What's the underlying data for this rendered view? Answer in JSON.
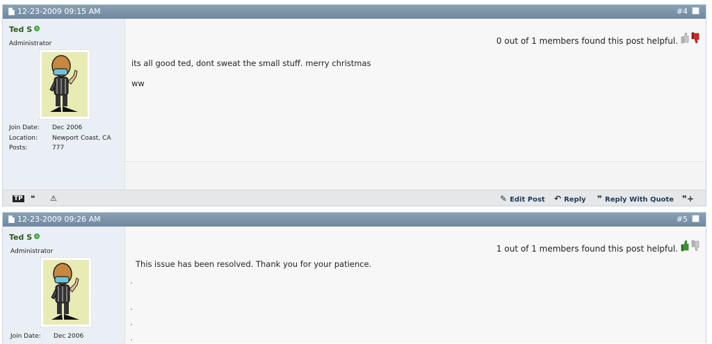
{
  "posts": [
    {
      "date": "12-23-2009 09:15 AM",
      "number": "#4",
      "user": {
        "name": "Ted S",
        "title": "Administrator"
      },
      "meta": [
        {
          "key": "Join Date:",
          "value": "Dec 2006"
        },
        {
          "key": "Location:",
          "value": "Newport Coast, CA"
        },
        {
          "key": "Posts:",
          "value": "777"
        }
      ],
      "helpful": "0 out of 1 members found this post helpful.",
      "message_lines": [
        "its all good ted, dont sweat the small stuff. merry christmas",
        "ww"
      ],
      "footer": {
        "edit_label": "Edit Post",
        "reply_label": "Reply",
        "quote_label": "Reply With Quote"
      }
    },
    {
      "date": "12-23-2009 09:26 AM",
      "number": "#5",
      "user": {
        "name": "Ted S",
        "title": "Administrator"
      },
      "meta": [
        {
          "key": "Join Date:",
          "value": "Dec 2006"
        }
      ],
      "helpful": "1 out of 1 members found this post helpful.",
      "message_lines": [
        "This issue has been resolved. Thank you for your patience."
      ]
    }
  ],
  "colors": {
    "header_bar": "#7b93a9",
    "username": "#2d5a15",
    "thumb_up_active": "#3a9a2a",
    "thumb_down_active": "#c02020",
    "thumb_inactive": "#b8b8b8"
  },
  "icons": [
    "document-icon",
    "online-status-icon",
    "thumb-up-icon",
    "thumb-down-icon",
    "text-icon",
    "quote-icon",
    "report-icon",
    "edit-icon",
    "reply-icon",
    "reply-with-quote-icon",
    "multi-quote-icon"
  ]
}
